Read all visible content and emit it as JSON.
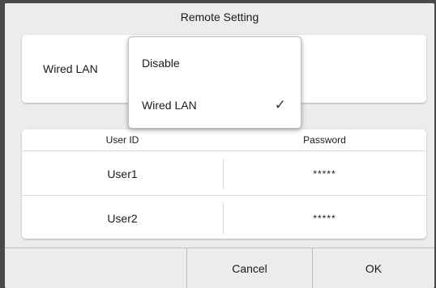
{
  "dialog": {
    "title": "Remote Setting"
  },
  "connection": {
    "selected_label": "Wired LAN"
  },
  "dropdown": {
    "options": [
      {
        "label": "Disable",
        "selected": false
      },
      {
        "label": "Wired LAN",
        "selected": true
      }
    ],
    "check_glyph": "✓"
  },
  "users_table": {
    "headers": [
      "User ID",
      "Password"
    ],
    "rows": [
      {
        "user_id": "User1",
        "password": "*****"
      },
      {
        "user_id": "User2",
        "password": "*****"
      }
    ]
  },
  "buttons": {
    "cancel": "Cancel",
    "ok": "OK"
  }
}
